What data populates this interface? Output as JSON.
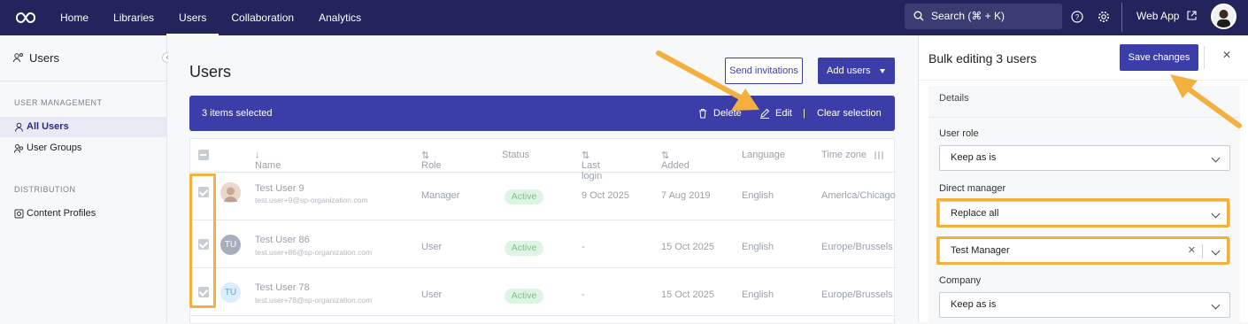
{
  "nav": {
    "links": [
      "Home",
      "Libraries",
      "Users",
      "Collaboration",
      "Analytics"
    ],
    "active": "Users",
    "search_placeholder": "Search (⌘ + K)",
    "web_app": "Web App"
  },
  "sidebar": {
    "title": "Users",
    "sections": [
      {
        "heading": "USER MANAGEMENT",
        "items": [
          {
            "label": "All Users",
            "active": true
          },
          {
            "label": "User Groups",
            "active": false
          }
        ]
      },
      {
        "heading": "DISTRIBUTION",
        "items": [
          {
            "label": "Content Profiles",
            "active": false
          }
        ]
      }
    ]
  },
  "main": {
    "title": "Users",
    "send_invitations": "Send invitations",
    "add_users": "Add users",
    "selection": {
      "count_text": "3 items selected",
      "delete": "Delete",
      "edit": "Edit",
      "divider": "|",
      "clear": "Clear selection"
    },
    "columns": [
      "Name",
      "Role",
      "Status",
      "Last login",
      "Added",
      "Language",
      "Time zone"
    ],
    "rows": [
      {
        "name": "Test User 9",
        "email": "test.user+9@sp-organization.com",
        "role": "Manager",
        "status": "Active",
        "last_login": "9 Oct 2025",
        "added": "7 Aug 2019",
        "language": "English",
        "timezone": "America/Chicago",
        "avatar_text": "",
        "avatar_color": "#d9c7b8"
      },
      {
        "name": "Test User 86",
        "email": "test.user+86@sp-organization.com",
        "role": "User",
        "status": "Active",
        "last_login": "-",
        "added": "15 Oct 2025",
        "language": "English",
        "timezone": "Europe/Brussels",
        "avatar_text": "TU",
        "avatar_color": "#a7adbc"
      },
      {
        "name": "Test User 78",
        "email": "test.user+78@sp-organization.com",
        "role": "User",
        "status": "Active",
        "last_login": "-",
        "added": "15 Oct 2025",
        "language": "English",
        "timezone": "Europe/Brussels",
        "avatar_text": "TU",
        "avatar_color": "#dbeefb"
      }
    ]
  },
  "panel": {
    "title": "Bulk editing 3 users",
    "save": "Save changes",
    "section": "Details",
    "user_role_label": "User role",
    "user_role_value": "Keep as is",
    "direct_manager_label": "Direct manager",
    "direct_manager_mode": "Replace all",
    "direct_manager_value": "Test Manager",
    "company_label": "Company",
    "company_value": "Keep as is"
  },
  "colors": {
    "nav_bg": "#22245b",
    "accent": "#3b3ea8",
    "highlight": "#f3b03d",
    "active_badge": "#dff4e4"
  }
}
